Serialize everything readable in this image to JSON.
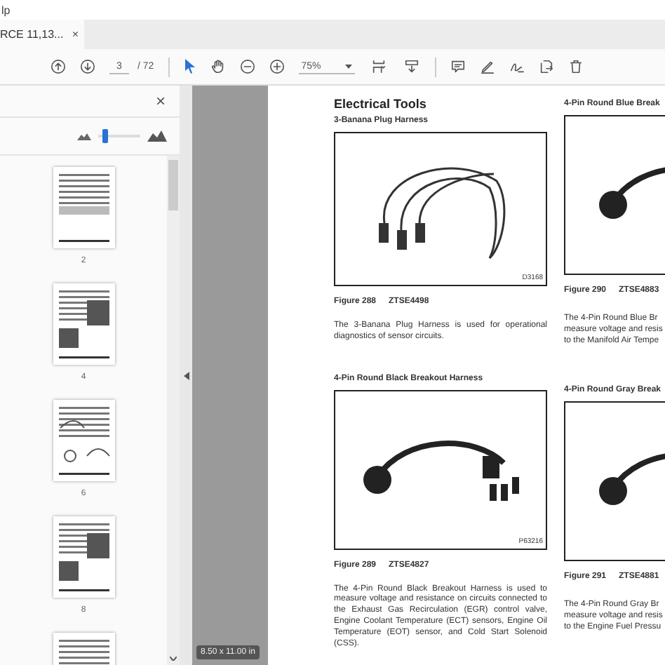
{
  "title_bar": {
    "text": "lp"
  },
  "tab": {
    "title": "RCE 11,13...",
    "close": "×"
  },
  "toolbar": {
    "page": "3",
    "page_count": "/ 72",
    "zoom": "75%"
  },
  "sidebar": {
    "close": "×",
    "thumbnail_size": {
      "level": 0.15
    },
    "thumbnails": [
      {
        "label": "2",
        "kind": "index"
      },
      {
        "label": "4",
        "kind": "photos"
      },
      {
        "label": "6",
        "kind": "drawings"
      },
      {
        "label": "8",
        "kind": "photos"
      }
    ]
  },
  "page_size": "8.50 x 11.00 in",
  "document": {
    "heading": "Electrical Tools",
    "left_column": [
      {
        "title": "3-Banana Plug Harness",
        "figure_label": "D3168",
        "figure": "Figure 288",
        "part": "ZTSE4498",
        "description": "The 3-Banana Plug Harness is used for operational diagnostics of sensor circuits."
      },
      {
        "title": "4-Pin Round Black Breakout Harness",
        "figure_label": "P63216",
        "figure": "Figure 289",
        "part": "ZTSE4827",
        "description": "The 4-Pin Round Black Breakout Harness is used to measure voltage and resistance on circuits connected to the Exhaust Gas Recirculation (EGR) control valve, Engine Coolant Temperature (ECT) sensors, Engine Oil Temperature (EOT) sensor, and Cold Start Solenoid (CSS)."
      }
    ],
    "right_column": [
      {
        "title": "4-Pin Round Blue Break",
        "figure": "Figure 290",
        "part": "ZTSE4883",
        "description_lines": [
          "The 4-Pin Round Blue Br",
          "measure voltage and resis",
          "to the Manifold Air Tempe"
        ]
      },
      {
        "title": "4-Pin Round Gray Break",
        "figure": "Figure 291",
        "part": "ZTSE4881",
        "description_lines": [
          "The 4-Pin Round Gray Br",
          "measure voltage and resis",
          "to the Engine Fuel Pressu"
        ]
      }
    ]
  }
}
